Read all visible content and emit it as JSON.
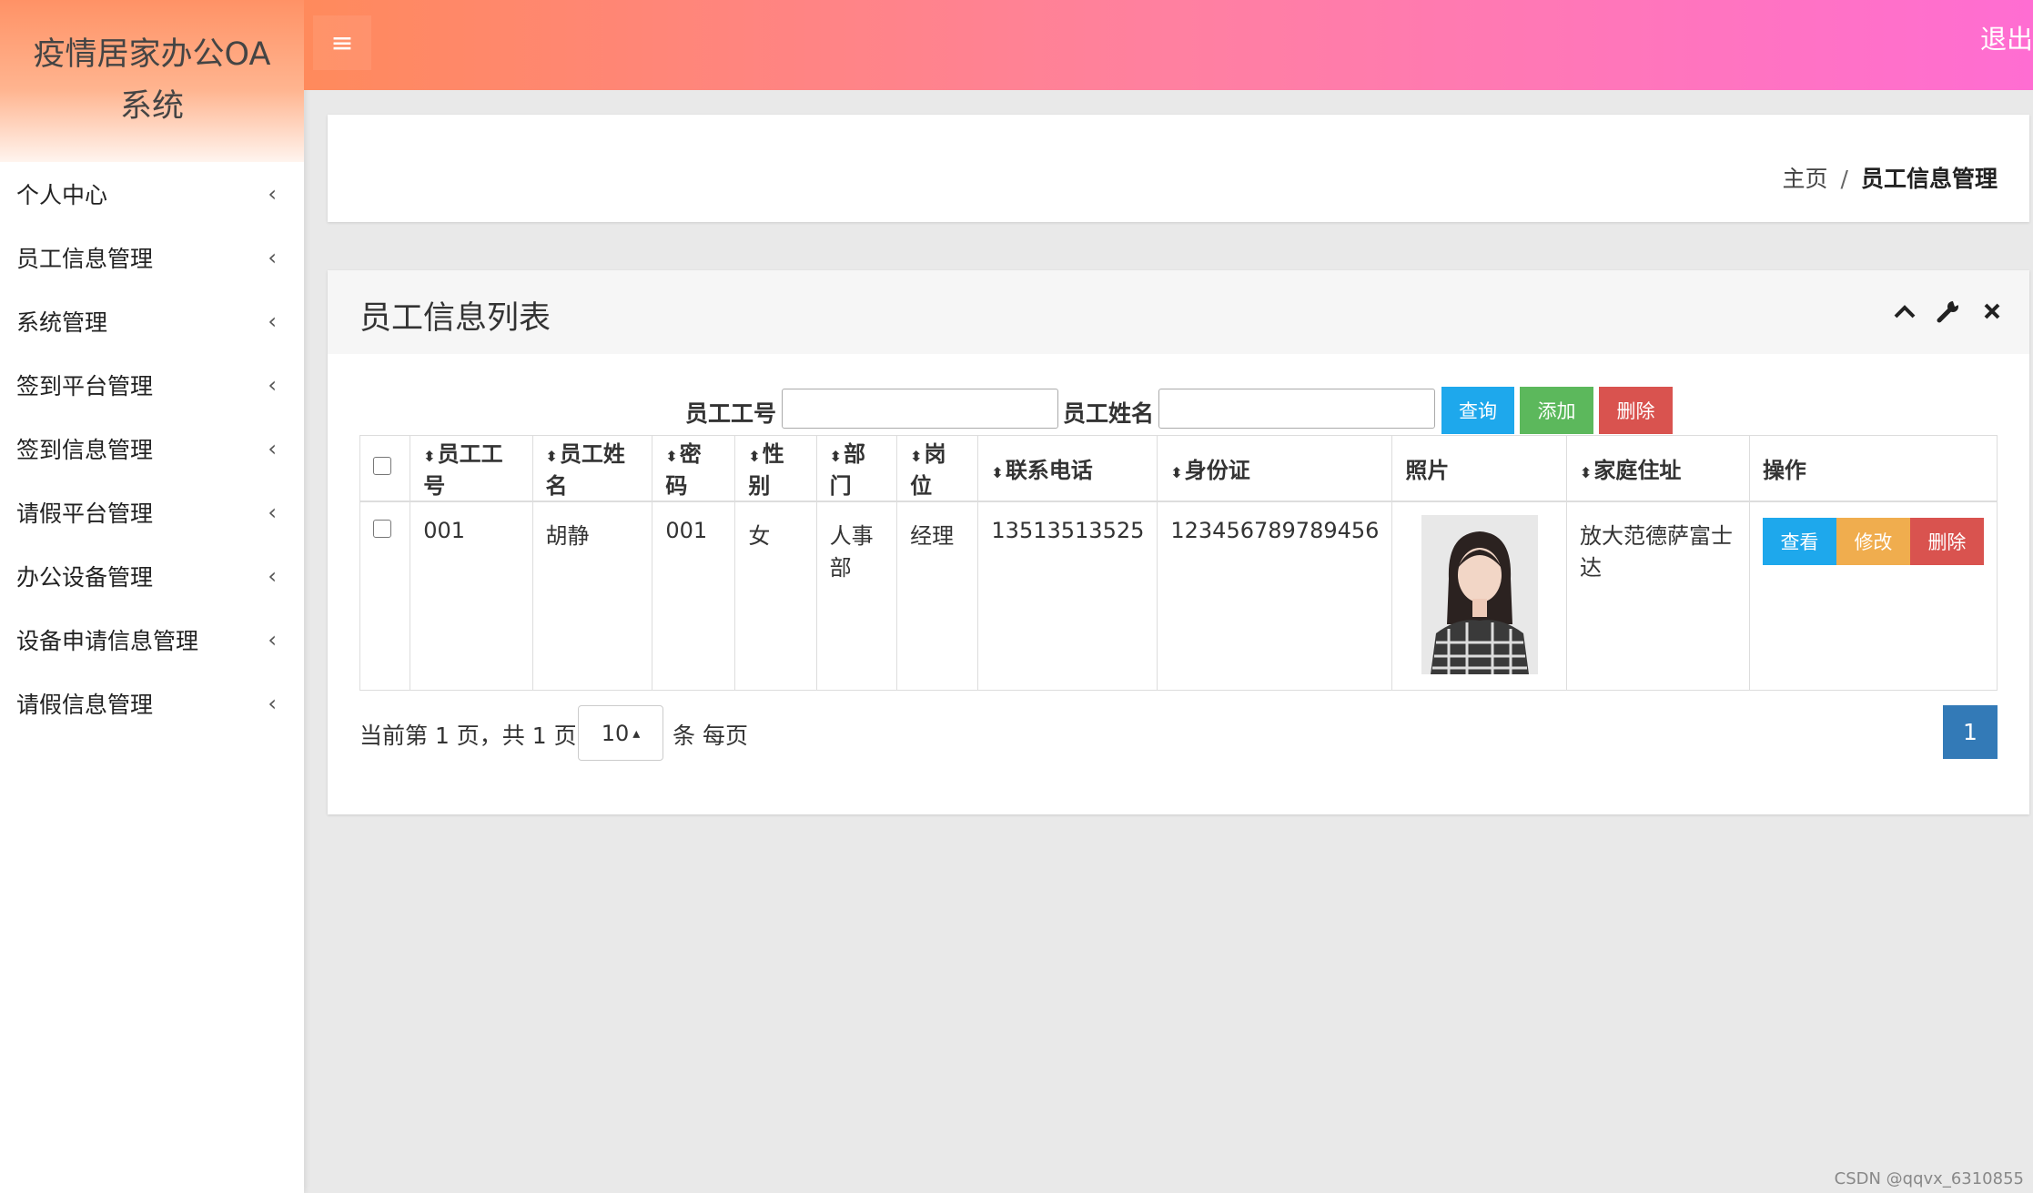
{
  "sidebar": {
    "brand_line1": "疫情居家办公OA",
    "brand_line2": "系统",
    "items": [
      {
        "label": "个人中心"
      },
      {
        "label": "员工信息管理"
      },
      {
        "label": "系统管理"
      },
      {
        "label": "签到平台管理"
      },
      {
        "label": "签到信息管理"
      },
      {
        "label": "请假平台管理"
      },
      {
        "label": "办公设备管理"
      },
      {
        "label": "设备申请信息管理"
      },
      {
        "label": "请假信息管理"
      }
    ],
    "chevron": "‹"
  },
  "topbar": {
    "menu_icon": "≡",
    "logout_label": "退出"
  },
  "breadcrumb": {
    "home": "主页",
    "separator": "/",
    "current": "员工信息管理"
  },
  "panel": {
    "title": "员工信息列表",
    "tools": [
      "chevron-up-icon",
      "wrench-icon",
      "close-icon"
    ]
  },
  "search": {
    "emp_no_label": "员工工号",
    "emp_no_value": "",
    "emp_name_label": "员工姓名",
    "emp_name_value": "",
    "query_label": "查询",
    "add_label": "添加",
    "delete_label": "删除"
  },
  "table": {
    "headers": {
      "emp_no": "员工工号",
      "emp_name": "员工姓名",
      "password": "密码",
      "gender": "性别",
      "dept": "部门",
      "post": "岗位",
      "phone": "联系电话",
      "id_card": "身份证",
      "photo": "照片",
      "address": "家庭住址",
      "actions": "操作"
    },
    "sort_icon": "⬍",
    "rows": [
      {
        "emp_no": "001",
        "emp_name": "胡静",
        "password": "001",
        "gender": "女",
        "dept": "人事部",
        "post": "经理",
        "phone": "13513513525",
        "id_card": "123456789789456",
        "address": "放大范德萨富士达",
        "view_label": "查看",
        "edit_label": "修改",
        "delete_label": "删除"
      }
    ]
  },
  "pager": {
    "info": "当前第 1 页，共 1 页",
    "page_size": "10",
    "page_size_caret": "▴",
    "per_page_suffix": "条 每页",
    "current_page": "1"
  },
  "watermark": "CSDN @qqvx_6310855",
  "colors": {
    "topbar_start": "#ff8a5c",
    "topbar_end": "#ff6dd2",
    "info": "#1ea8ec",
    "success": "#5cb85c",
    "danger": "#d9534f",
    "warning": "#f0ad4e",
    "primary": "#337ab7"
  }
}
